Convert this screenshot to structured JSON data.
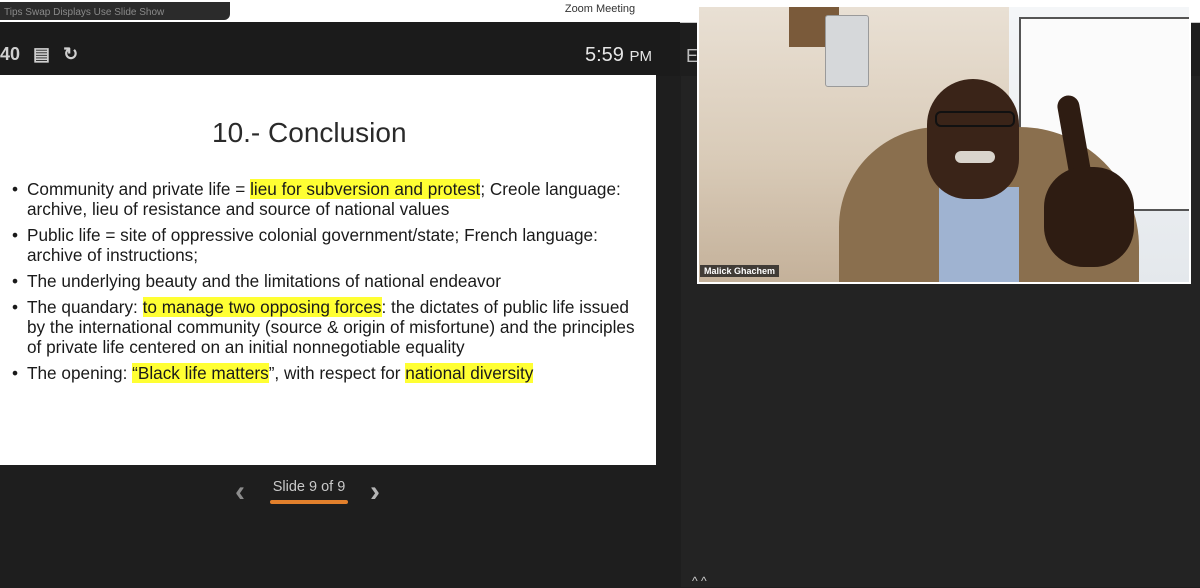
{
  "app": {
    "window_title": "Zoom Meeting",
    "menu_fragment": "Tips   Swap Displays   Use Slide Show"
  },
  "toolbar": {
    "left_fragment": "40",
    "icons": [
      "slides-grid-icon",
      "refresh-icon"
    ],
    "clock_time": "5:59",
    "clock_period": "PM",
    "side_letter": "E"
  },
  "slide": {
    "title": "10.- Conclusion",
    "bullets": [
      {
        "pre": "Community and private life = ",
        "hl": "lieu for subversion and protest",
        "post": "; Creole language: archive, lieu of resistance and source of national values"
      },
      {
        "pre": "Public life = site of oppressive colonial government/state; French language: archive of instructions;"
      },
      {
        "pre": "The underlying beauty and the limitations of national endeavor"
      },
      {
        "pre": "The quandary: ",
        "hl": "to manage two opposing forces",
        "post": ": the dictates of  public life issued by the international community (source & origin of misfortune) and the principles of private life centered on an initial nonnegotiable equality"
      },
      {
        "pre": "The opening: ",
        "hl": "“Black life matters",
        "post": "”, with respect for ",
        "hl2": "national diversity"
      }
    ],
    "highlight_color": "#ffff33"
  },
  "navigation": {
    "counter": "Slide 9 of 9",
    "underline_color": "#e2802c"
  },
  "video": {
    "participant_name": "Malick Ghachem"
  },
  "bottom": {
    "icons_text": "^ ^"
  }
}
